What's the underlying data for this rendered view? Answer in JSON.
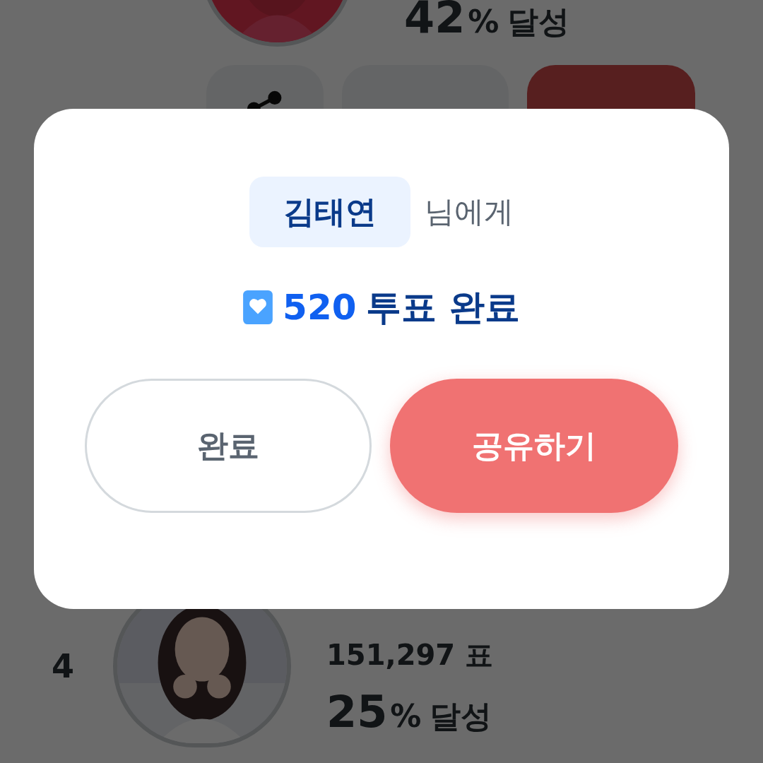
{
  "background": {
    "top_entry": {
      "percent": "42",
      "percent_sign": "%",
      "label": "달성"
    },
    "actions": [
      {
        "kind": "share"
      },
      {
        "kind": "text"
      },
      {
        "kind": "primary"
      }
    ],
    "bottom_entry": {
      "rank": "4",
      "votes": "151,297 표",
      "percent": "25",
      "percent_sign": "%",
      "label": "달성"
    }
  },
  "dialog": {
    "recipient": "김태연",
    "recipient_suffix": "님에게",
    "vote_count": "520",
    "vote_text": "투표 완료",
    "buttons": [
      {
        "kind": "secondary",
        "label": "완료"
      },
      {
        "kind": "primary",
        "label": "공유하기"
      }
    ]
  }
}
